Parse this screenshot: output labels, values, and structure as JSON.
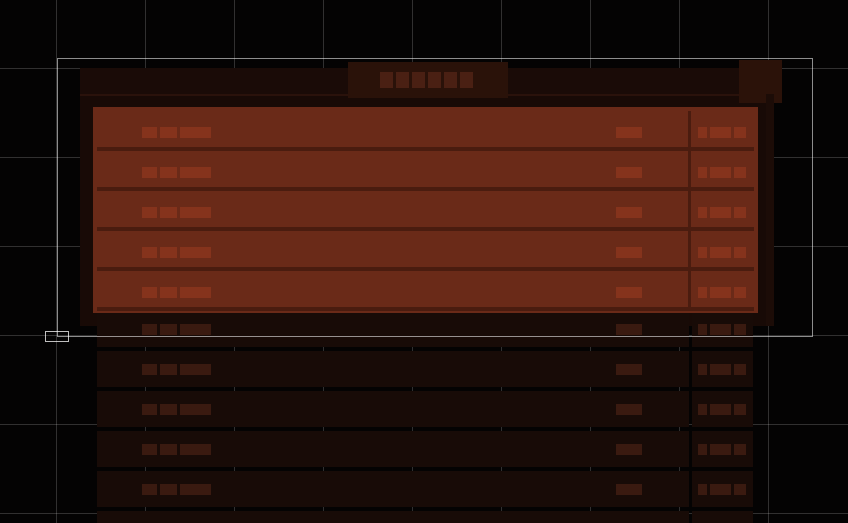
{
  "window": {
    "title_label": "",
    "accent_color": "#6a2a18",
    "dim_row_color": "#180b07"
  },
  "list": {
    "highlighted_rows": [
      {
        "index": 0
      },
      {
        "index": 1
      },
      {
        "index": 2
      },
      {
        "index": 3
      },
      {
        "index": 4
      }
    ],
    "dim_rows": [
      {
        "index": 5
      },
      {
        "index": 6
      },
      {
        "index": 7
      },
      {
        "index": 8
      },
      {
        "index": 9
      }
    ]
  },
  "icons": {
    "corner_button": "square-icon",
    "handle": "resize-handle-icon"
  }
}
